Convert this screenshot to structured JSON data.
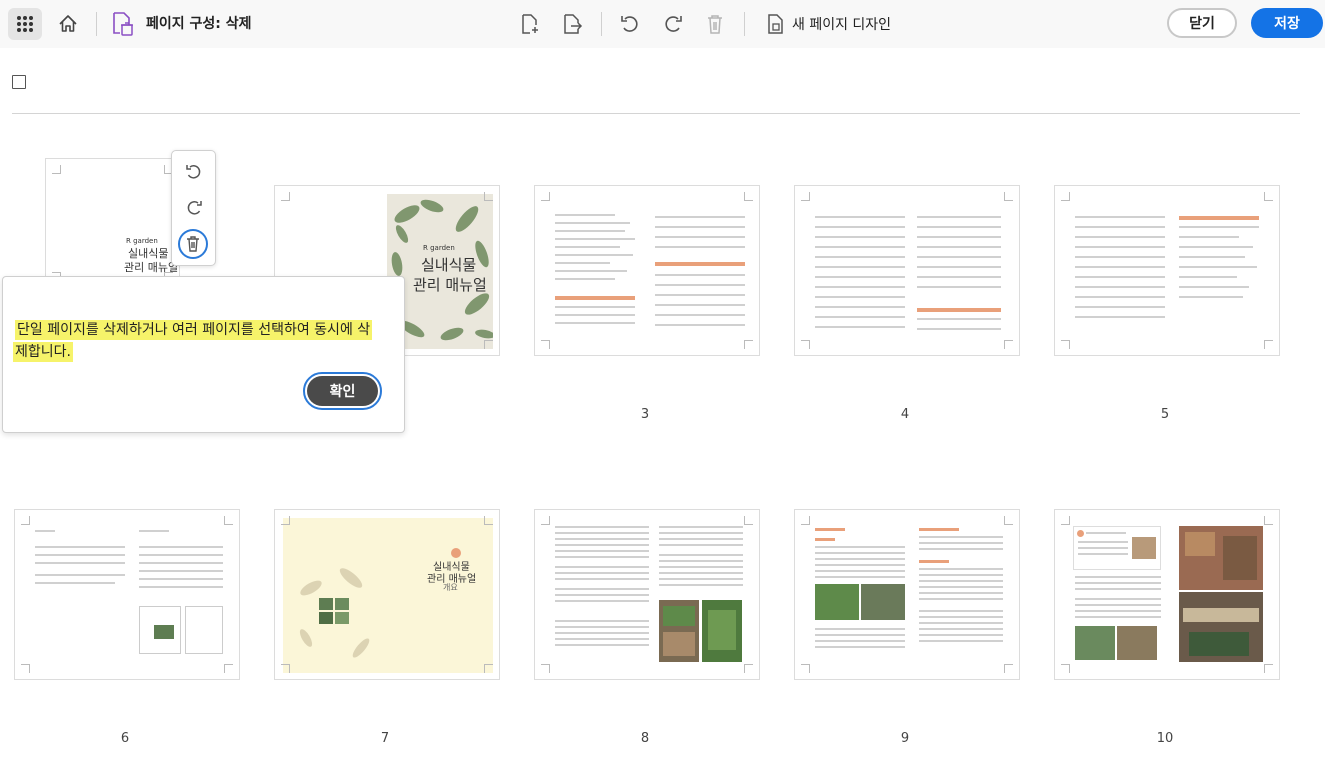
{
  "toolbar": {
    "title": "페이지 구성: 삭제",
    "new_page_design": "새 페이지 디자인",
    "close_label": "닫기",
    "save_label": "저장"
  },
  "tooltip": {
    "line1": "단일 페이지를 삭제하거나 여러 페이지를 선택하여 동시에 삭",
    "line2": "제합니다.",
    "confirm_label": "확인"
  },
  "pages": [
    {
      "number": "",
      "title_small": "R garden",
      "title_main": "실내식물",
      "title_sub": "관리 매뉴얼"
    },
    {
      "number": "",
      "title_small": "R garden",
      "title_main": "실내식물",
      "title_sub": "관리 매뉴얼"
    },
    {
      "number": "3"
    },
    {
      "number": "4"
    },
    {
      "number": "5"
    },
    {
      "number": "6"
    },
    {
      "number": "7",
      "title_main": "실내식물",
      "title_sub": "관리 매뉴얼",
      "title_small": "개요"
    },
    {
      "number": "8"
    },
    {
      "number": "9"
    },
    {
      "number": "10"
    }
  ],
  "icons": [
    "apps-grid-icon",
    "home-icon",
    "organize-delete-icon",
    "insert-page-icon",
    "extract-page-icon",
    "undo-icon",
    "redo-icon",
    "delete-icon",
    "new-page-design-icon",
    "rotate-left-icon",
    "rotate-right-icon",
    "trash-icon"
  ],
  "colors": {
    "accent_blue": "#1473e6",
    "highlight": "#f6f36a",
    "confirm_dark": "#4a4a4a"
  }
}
